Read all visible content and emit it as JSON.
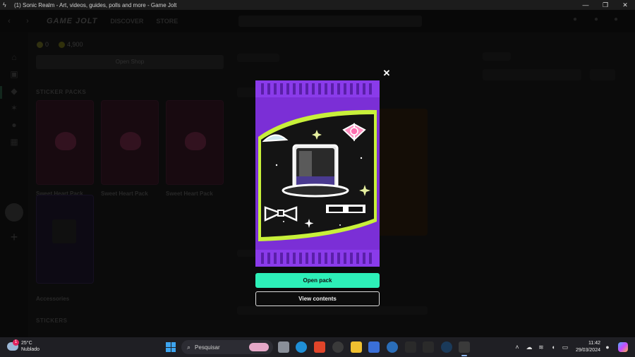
{
  "window": {
    "title": "(1) Sonic Realm - Art, videos, guides, polls and more - Game Jolt",
    "controls": [
      "—",
      "❐",
      "✕"
    ]
  },
  "topnav": {
    "logo": "GAME JOLT",
    "links": [
      "DISCOVER",
      "STORE"
    ]
  },
  "shop": {
    "currency_a": "0",
    "currency_b": "4,900",
    "open_shop_label": "Open Shop",
    "sticker_packs_heading": "STICKER PACKS",
    "packs": [
      {
        "label": "Sweet Heart Pack"
      },
      {
        "label": "Sweet Heart Pack"
      },
      {
        "label": "Sweet Heart Pack"
      }
    ],
    "accessories_label": "Accessories",
    "stickers_heading": "STICKERS"
  },
  "modal": {
    "close_label": "✕",
    "open_pack_label": "Open pack",
    "view_contents_label": "View contents",
    "colors": {
      "accent": "#2df0b8",
      "pack_purple": "#7b2fd6",
      "lime": "#c8f03a"
    }
  },
  "taskbar": {
    "weather_temp": "25°C",
    "weather_desc": "Nublado",
    "weather_badge": "1",
    "search_placeholder": "Pesquisar",
    "time": "11:42",
    "date": "29/03/2024"
  }
}
